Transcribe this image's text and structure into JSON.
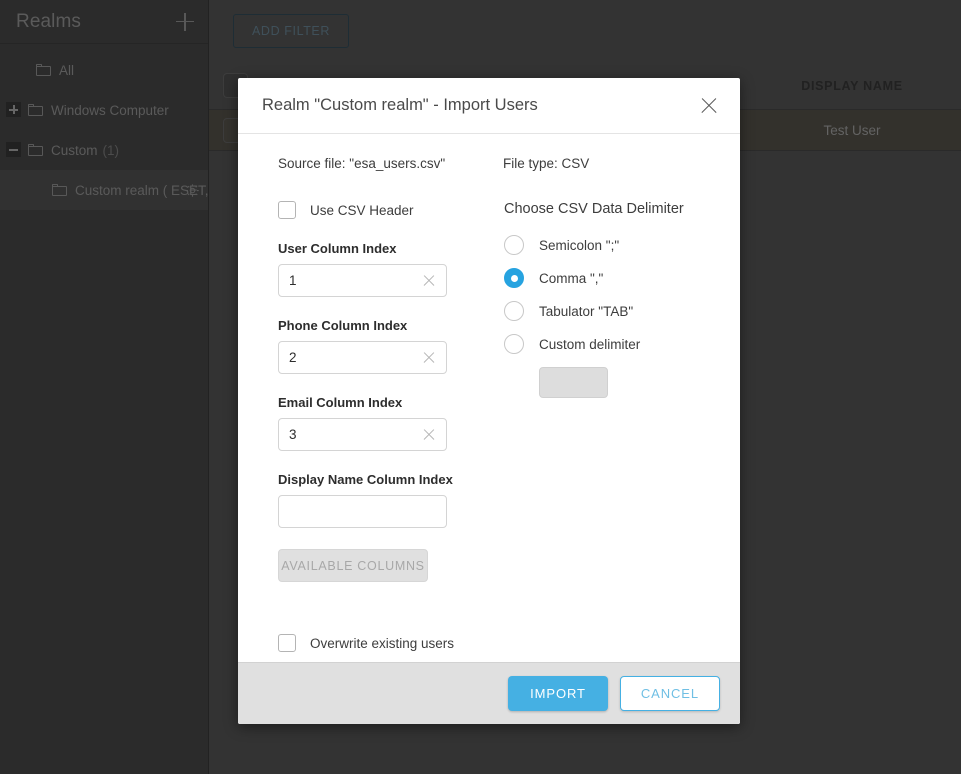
{
  "colors": {
    "accent": "#45b0e3",
    "radio_selected": "#27a3e0",
    "sidebar_bg": "#3d3d3d",
    "main_bg": "#4a4a4a",
    "row_highlight": "#4b473e",
    "footer_bg": "#e0e0e0",
    "disabled_text": "#a8a8a8"
  },
  "sidebar": {
    "title": "Realms",
    "add_icon": "plus-icon",
    "items": [
      {
        "label": "All",
        "count": "",
        "expander": "none",
        "indent": 1,
        "selected": false,
        "gear": false
      },
      {
        "label": "Windows Computer",
        "count": "",
        "expander": "plus",
        "indent": 0,
        "selected": false,
        "gear": false
      },
      {
        "label": "Custom",
        "count": "(1)",
        "expander": "minus",
        "indent": 0,
        "selected": false,
        "gear": false
      },
      {
        "label": "Custom realm ( ESET, s...",
        "count": "",
        "expander": "none",
        "indent": 2,
        "selected": true,
        "gear": true
      }
    ]
  },
  "main": {
    "add_filter_label": "ADD FILTER",
    "table": {
      "columns": [
        "DISPLAY NAME"
      ],
      "rows": [
        {
          "display_name": "Test User"
        }
      ]
    }
  },
  "dialog": {
    "title": "Realm \"Custom realm\" - Import Users",
    "close_icon": "close-icon",
    "source_file_label": "Source file: \"esa_users.csv\"",
    "file_type_label": "File type: CSV",
    "use_csv_header": {
      "label": "Use CSV Header",
      "checked": false
    },
    "fields": [
      {
        "label": "User Column Index",
        "value": "1",
        "placeholder": "",
        "clearable": true
      },
      {
        "label": "Phone Column Index",
        "value": "2",
        "placeholder": "",
        "clearable": true
      },
      {
        "label": "Email Column Index",
        "value": "3",
        "placeholder": "",
        "clearable": true
      },
      {
        "label": "Display Name Column Index",
        "value": "",
        "placeholder": "",
        "clearable": false
      }
    ],
    "available_columns_label": "AVAILABLE COLUMNS",
    "available_columns_disabled": true,
    "overwrite_existing": {
      "label": "Overwrite existing users",
      "checked": false
    },
    "delimiter": {
      "title": "Choose CSV Data Delimiter",
      "options": [
        {
          "label": "Semicolon \";\"",
          "selected": false
        },
        {
          "label": "Comma \",\"",
          "selected": true
        },
        {
          "label": "Tabulator \"TAB\"",
          "selected": false
        },
        {
          "label": "Custom delimiter",
          "selected": false
        }
      ],
      "custom_value": "",
      "custom_disabled": true
    },
    "footer": {
      "import_label": "IMPORT",
      "cancel_label": "CANCEL"
    }
  }
}
